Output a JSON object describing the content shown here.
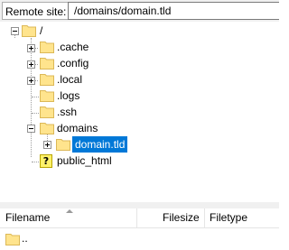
{
  "site_bar": {
    "label": "Remote site:",
    "path": "/domains/domain.tld"
  },
  "tree": {
    "root": "/",
    "nodes": [
      {
        "name": ".cache",
        "expandable": true
      },
      {
        "name": ".config",
        "expandable": true
      },
      {
        "name": ".local",
        "expandable": true
      },
      {
        "name": ".logs",
        "expandable": false
      },
      {
        "name": ".ssh",
        "expandable": false
      },
      {
        "name": "domains",
        "expanded": true
      },
      {
        "name": "domain.tld",
        "selected": true,
        "expandable": true
      },
      {
        "name": "public_html",
        "icon": "unknown-question-icon",
        "icon_text": "?"
      }
    ]
  },
  "file_list": {
    "columns": [
      "Filename",
      "Filesize",
      "Filetype"
    ],
    "rows": [
      {
        "name": ".."
      }
    ]
  },
  "colors": {
    "selection": "#0078d7",
    "folder_fill": "#ffe48d",
    "folder_edge": "#dcb857"
  }
}
